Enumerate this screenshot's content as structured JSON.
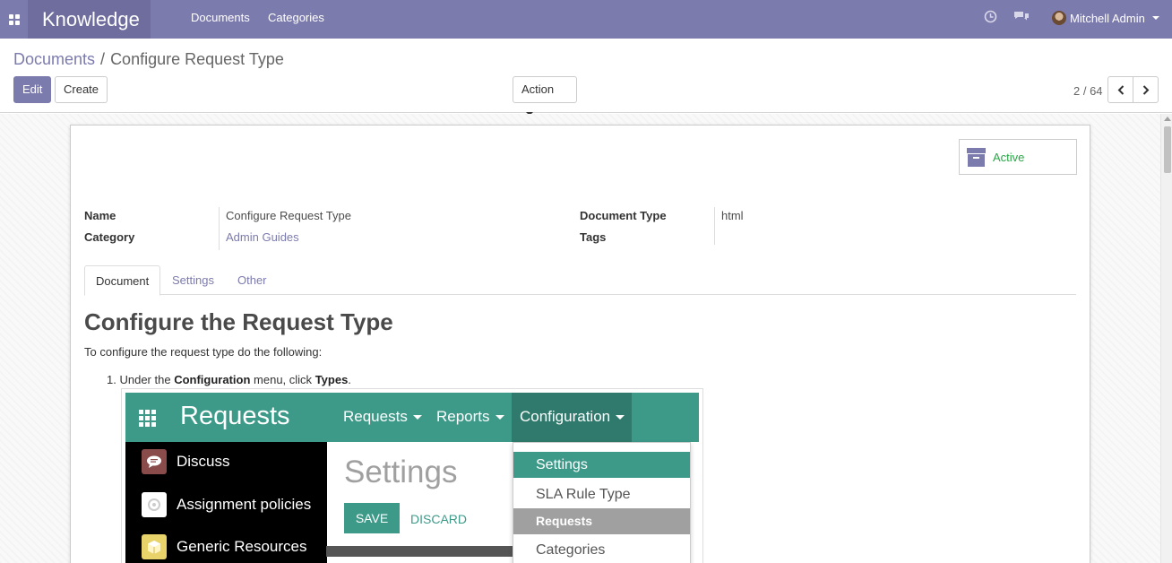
{
  "navbar": {
    "app_name": "Knowledge",
    "menu": [
      "Documents",
      "Categories"
    ],
    "user_name": "Mitchell Admin"
  },
  "control_panel": {
    "breadcrumb": [
      "Documents",
      "Configure Request Type"
    ],
    "edit_label": "Edit",
    "create_label": "Create",
    "action_label": "Action",
    "pager": "2 / 64"
  },
  "form": {
    "status_button": "Active",
    "fields": {
      "name_label": "Name",
      "name_value": "Configure Request Type",
      "category_label": "Category",
      "category_value": "Admin Guides",
      "document_type_label": "Document Type",
      "document_type_value": "html",
      "tags_label": "Tags"
    },
    "tabs": [
      "Document",
      "Settings",
      "Other"
    ]
  },
  "document": {
    "title": "Configure the Request Type",
    "intro": "To configure the request type do the following:",
    "step1": {
      "number": "1.",
      "text_pre": "Under the",
      "menu_name": "Configuration",
      "text_mid": "menu, click",
      "target": "Types",
      "text_end": "."
    }
  },
  "screenshot": {
    "app_name": "Requests",
    "menu": [
      "Requests",
      "Reports",
      "Configuration"
    ],
    "sidebar_apps": [
      "Discuss",
      "Assignment policies",
      "Generic Resources"
    ],
    "page_title": "Settings",
    "save_label": "SAVE",
    "discard_label": "DISCARD",
    "dropdown": [
      "Settings",
      "SLA Rule Type",
      "Requests",
      "Categories"
    ]
  },
  "colors": {
    "brand": "#7c7bad",
    "active_status": "#28a745",
    "screenshot_accent": "#3d9a89"
  }
}
